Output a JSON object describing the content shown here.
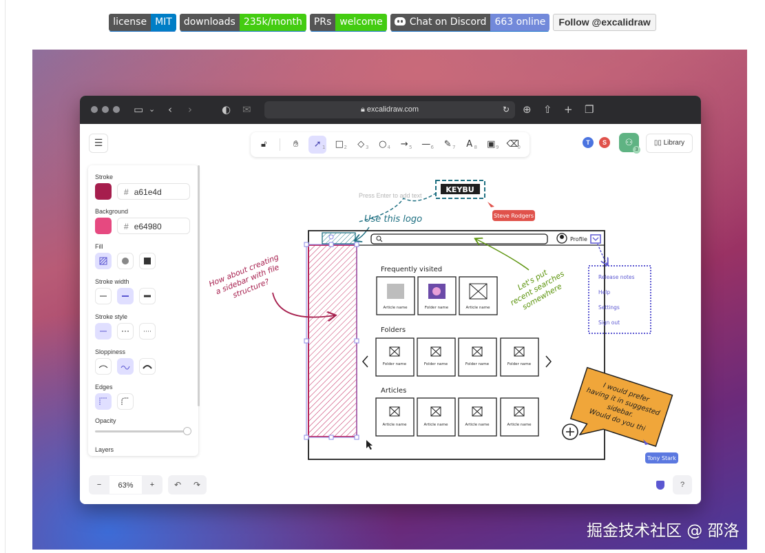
{
  "badges": [
    {
      "left": "license",
      "right": "MIT",
      "color": "#007ec6"
    },
    {
      "left": "downloads",
      "right": "235k/month",
      "color": "#4c1"
    },
    {
      "left": "PRs",
      "right": "welcome",
      "color": "#4c1"
    },
    {
      "left": "Chat on Discord",
      "right": "663 online",
      "color": "#7289da"
    }
  ],
  "follow_badge": "Follow @excalidraw",
  "browser": {
    "url": "excalidraw.com"
  },
  "toolbar": {
    "tools": [
      {
        "icon": "lock-icon",
        "key": ""
      },
      {
        "icon": "hand-icon",
        "key": ""
      },
      {
        "icon": "selection-arrow-icon",
        "key": "1"
      },
      {
        "icon": "rectangle-icon",
        "key": "2"
      },
      {
        "icon": "diamond-icon",
        "key": "3"
      },
      {
        "icon": "ellipse-icon",
        "key": "4"
      },
      {
        "icon": "arrow-icon",
        "key": "5"
      },
      {
        "icon": "line-icon",
        "key": "6"
      },
      {
        "icon": "pencil-icon",
        "key": "7"
      },
      {
        "icon": "text-icon",
        "key": "8"
      },
      {
        "icon": "image-icon",
        "key": "9"
      },
      {
        "icon": "eraser-icon",
        "key": "0"
      }
    ],
    "hint": "Press Enter to add text"
  },
  "collaborators": [
    {
      "initial": "T",
      "color": "#4b74e0"
    },
    {
      "initial": "S",
      "color": "#e0524b"
    }
  ],
  "share_count": "3",
  "library_label": "Library",
  "panel": {
    "stroke_label": "Stroke",
    "stroke_hex": "a61e4d",
    "stroke_color": "#a61e4d",
    "background_label": "Background",
    "background_hex": "e64980",
    "background_color": "#e64980",
    "hash": "#",
    "fill_label": "Fill",
    "stroke_width_label": "Stroke width",
    "stroke_style_label": "Stroke style",
    "sloppiness_label": "Sloppiness",
    "edges_label": "Edges",
    "opacity_label": "Opacity",
    "opacity_value": 1.0,
    "layers_label": "Layers"
  },
  "zoom": {
    "minus": "−",
    "value": "63%",
    "plus": "+"
  },
  "drawing": {
    "logo_text": "KEYBU",
    "use_logo": "Use this logo",
    "steve_tag": "Steve Rodgers",
    "sidebar_note": [
      "How about creating",
      "a sidebar with file",
      "structure?"
    ],
    "recent_note": [
      "Let's put",
      "recent searches",
      "somewhere"
    ],
    "profile_label": "Profile",
    "dropdown_items": [
      "Release notes",
      "Help",
      "Settings",
      "Sign out"
    ],
    "frequently_visited": "Frequently visited",
    "folders": "Folders",
    "articles": "Articles",
    "article_name": "Article name",
    "folder_name": "Folder name",
    "sticky_note": [
      "I would prefer",
      "having it in suggested",
      "sidebar.",
      "Would do you thi"
    ],
    "tony_tag": "Tony Stark"
  },
  "watermark": "掘金技术社区 @ 邵洛"
}
